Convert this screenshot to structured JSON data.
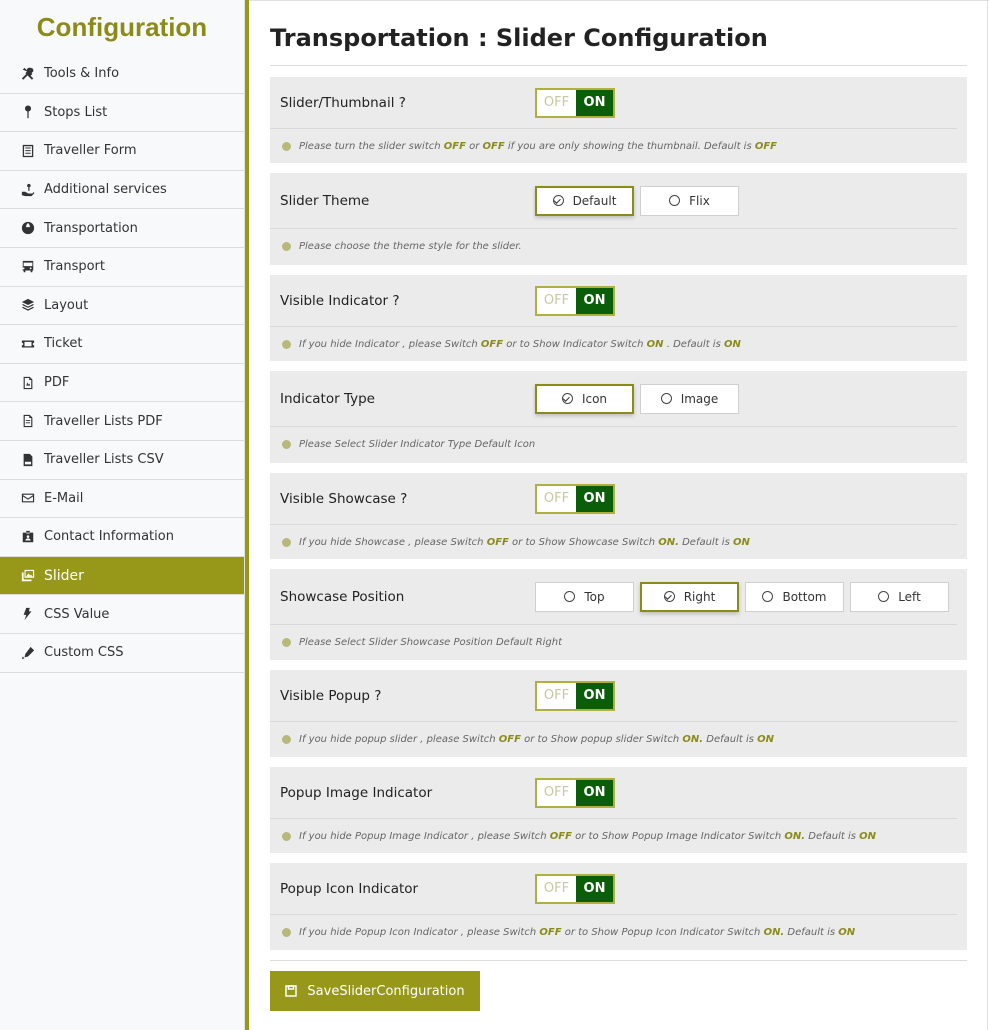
{
  "sidebar": {
    "title": "Configuration",
    "items": [
      {
        "label": "Tools & Info",
        "icon": "tools-icon"
      },
      {
        "label": "Stops List",
        "icon": "pin-icon"
      },
      {
        "label": "Traveller Form",
        "icon": "form-icon"
      },
      {
        "label": "Additional services",
        "icon": "service-hand-icon"
      },
      {
        "label": "Transportation",
        "icon": "globe-icon"
      },
      {
        "label": "Transport",
        "icon": "bus-icon"
      },
      {
        "label": "Layout",
        "icon": "layers-icon"
      },
      {
        "label": "Ticket",
        "icon": "ticket-icon"
      },
      {
        "label": "PDF",
        "icon": "pdf-icon"
      },
      {
        "label": "Traveller Lists PDF",
        "icon": "file-icon"
      },
      {
        "label": "Traveller Lists CSV",
        "icon": "csv-icon"
      },
      {
        "label": "E-Mail",
        "icon": "envelope-icon"
      },
      {
        "label": "Contact Information",
        "icon": "id-card-icon"
      },
      {
        "label": "Slider",
        "icon": "images-icon",
        "active": true
      },
      {
        "label": "CSS Value",
        "icon": "css-icon"
      },
      {
        "label": "Custom CSS",
        "icon": "pen-icon"
      }
    ]
  },
  "main": {
    "title": "Transportation : Slider Configuration",
    "toggle_off": "OFF",
    "toggle_on": "ON",
    "sections": {
      "slider_thumbnail": {
        "label": "Slider/Thumbnail ?",
        "info_a": "Please turn the slider switch ",
        "info_b": "OFF",
        "info_c": " or ",
        "info_d": "OFF",
        "info_e": " if you are only showing the thumbnail. Default is ",
        "info_f": "OFF"
      },
      "slider_theme": {
        "label": "Slider Theme",
        "options": [
          "Default",
          "Flix"
        ],
        "selected": "Default",
        "info": "Please choose the theme style for the slider."
      },
      "visible_indicator": {
        "label": "Visible Indicator ?",
        "info_a": "If you hide Indicator , please Switch ",
        "info_b": "OFF",
        "info_c": " or to Show Indicator Switch ",
        "info_d": "ON",
        "info_e": " . Default is ",
        "info_f": "ON"
      },
      "indicator_type": {
        "label": "Indicator Type",
        "options": [
          "Icon",
          "Image"
        ],
        "selected": "Icon",
        "info": "Please Select Slider Indicator Type Default Icon"
      },
      "visible_showcase": {
        "label": "Visible Showcase ?",
        "info_a": "If you hide Showcase , please Switch ",
        "info_b": "OFF",
        "info_c": " or to Show Showcase Switch ",
        "info_d": "ON.",
        "info_e": " Default is ",
        "info_f": "ON"
      },
      "showcase_position": {
        "label": "Showcase Position",
        "options": [
          "Top",
          "Right",
          "Bottom",
          "Left"
        ],
        "selected": "Right",
        "info": "Please Select Slider Showcase Position Default Right"
      },
      "visible_popup": {
        "label": "Visible Popup ?",
        "info_a": "If you hide popup slider , please Switch ",
        "info_b": "OFF",
        "info_c": " or to Show popup slider Switch ",
        "info_d": "ON.",
        "info_e": " Default is ",
        "info_f": "ON"
      },
      "popup_image_indicator": {
        "label": "Popup Image Indicator",
        "info_a": "If you hide Popup Image Indicator , please Switch ",
        "info_b": "OFF",
        "info_c": " or to Show Popup Image Indicator Switch ",
        "info_d": "ON.",
        "info_e": " Default is ",
        "info_f": "ON"
      },
      "popup_icon_indicator": {
        "label": "Popup Icon Indicator",
        "info_a": "If you hide Popup Icon Indicator , please Switch ",
        "info_b": "OFF",
        "info_c": " or to Show Popup Icon Indicator Switch ",
        "info_d": "ON.",
        "info_e": " Default is ",
        "info_f": "ON"
      }
    },
    "save_label": "SaveSliderConfiguration"
  },
  "colors": {
    "accent": "#97981a",
    "title_olive": "#8b8b1a",
    "toggle_on": "#0a5e0a"
  }
}
